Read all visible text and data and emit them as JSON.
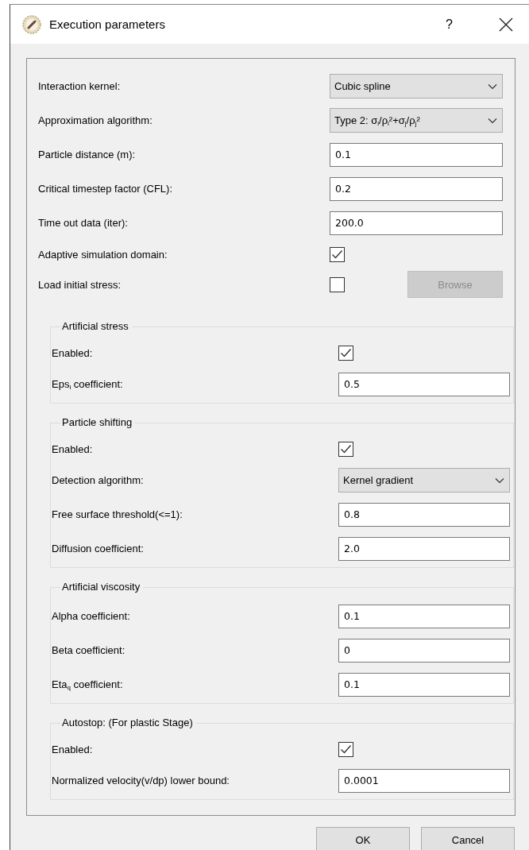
{
  "window": {
    "title": "Execution parameters",
    "help": "?"
  },
  "parameters": [
    {
      "kind": "combo",
      "label": "Interaction kernel:",
      "value": "Cubic spline"
    },
    {
      "kind": "combo",
      "label": "Approximation algorithm:",
      "value": "Type 2: σ$_{i}$/ρ$_{i}$²+σ$_{j}$/ρ$_{j}$²"
    },
    {
      "kind": "text",
      "label": "Particle distance (m):",
      "value": "0.1"
    },
    {
      "kind": "text",
      "label": "Critical timestep factor (CFL):",
      "value": "0.2"
    },
    {
      "kind": "text",
      "label": "Time out data (iter):",
      "value": "200.0"
    },
    {
      "kind": "check",
      "label": "Adaptive simulation domain:",
      "checked": true
    },
    {
      "kind": "check",
      "label": "Load initial stress:",
      "checked": false,
      "button": {
        "label": "Browse",
        "disabled": true
      }
    }
  ],
  "groups": [
    {
      "title": "Artificial stress",
      "rows": [
        {
          "kind": "check",
          "label": "Enabled:",
          "checked": true
        },
        {
          "kind": "text",
          "label": "Eps$_{i}$ coefficient:",
          "value": "0.5"
        }
      ]
    },
    {
      "title": "Particle shifting",
      "rows": [
        {
          "kind": "check",
          "label": "Enabled:",
          "checked": true
        },
        {
          "kind": "combo",
          "label": "Detection algorithm:",
          "value": "Kernel gradient"
        },
        {
          "kind": "text",
          "label": "Free surface threshold(<=1):",
          "value": "0.8"
        },
        {
          "kind": "text",
          "label": "Diffusion coefficient:",
          "value": "2.0"
        }
      ]
    },
    {
      "title": "Artificial viscosity",
      "rows": [
        {
          "kind": "text",
          "label": "Alpha coefficient:",
          "value": "0.1"
        },
        {
          "kind": "text",
          "label": "Beta coefficient:",
          "value": "0"
        },
        {
          "kind": "text",
          "label": "Eta$_{q}$ coefficient:",
          "value": "0.1"
        }
      ]
    },
    {
      "title": "Autostop: (For plastic Stage)",
      "rows": [
        {
          "kind": "check",
          "label": "Enabled:",
          "checked": true
        },
        {
          "kind": "text",
          "label": "Normalized velocity(v/dp) lower bound:",
          "value": "0.0001"
        }
      ]
    }
  ],
  "buttons": [
    "OK",
    "Cancel"
  ]
}
